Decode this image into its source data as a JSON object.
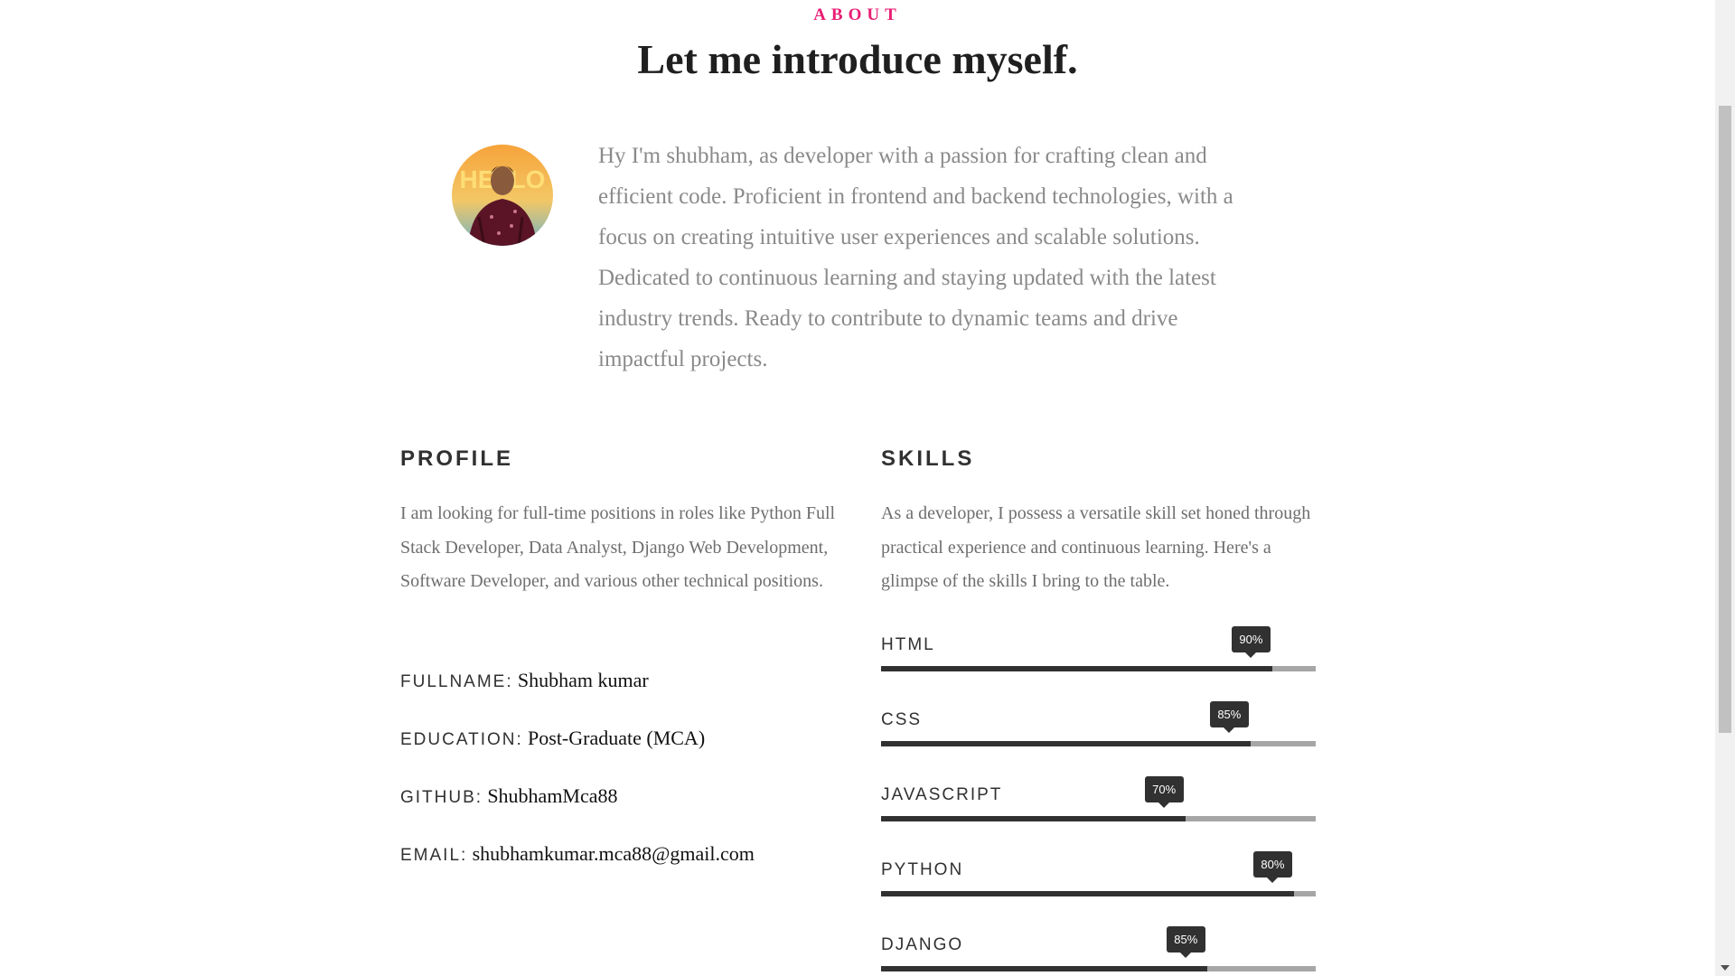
{
  "header": {
    "eyebrow": "ABOUT",
    "title": "Let me introduce myself."
  },
  "intro": {
    "avatar_alt": "profile photo",
    "text": "Hy I'm shubham, as developer with a passion for crafting clean and efficient code. Proficient in frontend and backend technologies, with a focus on creating intuitive user experiences and scalable solutions. Dedicated to continuous learning and staying updated with the latest industry trends. Ready to contribute to dynamic teams and drive impactful projects."
  },
  "profile": {
    "heading": "PROFILE",
    "description": "I am looking for full-time positions in roles like Python Full Stack Developer, Data Analyst, Django Web Development, Software Developer, and various other technical positions.",
    "info": [
      {
        "key": "FULLNAME:",
        "value": "Shubham kumar"
      },
      {
        "key": "EDUCATION:",
        "value": "Post-Graduate (MCA)"
      },
      {
        "key": "GITHUB:",
        "value": "ShubhamMca88"
      },
      {
        "key": "EMAIL:",
        "value": "shubhamkumar.mca88@gmail.com"
      }
    ]
  },
  "skills": {
    "heading": "SKILLS",
    "description": "As a developer, I possess a versatile skill set honed through practical experience and continuous learning. Here's a glimpse of the skills I bring to the table.",
    "items": [
      {
        "name": "HTML",
        "label": "90%",
        "fill": 0.9
      },
      {
        "name": "CSS",
        "label": "85%",
        "fill": 0.85
      },
      {
        "name": "JAVASCRIPT",
        "label": "70%",
        "fill": 0.7
      },
      {
        "name": "PYTHON",
        "label": "80%",
        "fill": 0.95
      },
      {
        "name": "DJANGO",
        "label": "85%",
        "fill": 0.75
      }
    ]
  },
  "colors": {
    "accent": "#e91e74",
    "dark": "#313131",
    "track": "#a6a6a6",
    "body_text": "#8a8a8a"
  }
}
